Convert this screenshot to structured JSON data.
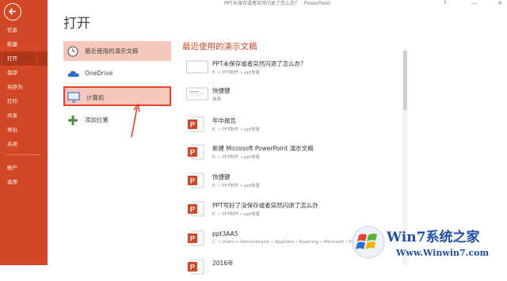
{
  "window": {
    "title": "PPT未保存或者突然闪退了怎么办？ - PowerPoint",
    "help": "?",
    "minimize": "—",
    "close": "✕"
  },
  "sidebar": {
    "items": [
      {
        "label": "信息"
      },
      {
        "label": "新建"
      },
      {
        "label": "打开",
        "active": true
      },
      {
        "label": "保存"
      },
      {
        "label": "另存为"
      },
      {
        "label": "打印"
      },
      {
        "label": "共享"
      },
      {
        "label": "导出"
      },
      {
        "label": "关闭"
      },
      {
        "label": "帐户"
      },
      {
        "label": "选项"
      }
    ],
    "accent": "#d24726"
  },
  "page_title": "打开",
  "locations": [
    {
      "label": "最近使用的演示文稿",
      "icon": "clock-icon"
    },
    {
      "label": "OneDrive",
      "icon": "cloud-icon"
    },
    {
      "label": "计算机",
      "icon": "computer-icon"
    },
    {
      "label": "添加位置",
      "icon": "plus-icon"
    }
  ],
  "recent": {
    "title": "最近使用的演示文稿",
    "items": [
      {
        "name": "PPT未保存或者突然闪退了怎么办？",
        "path": "E: » PPT制作 » ppt恢复",
        "icon": "blank-thumb"
      },
      {
        "name": "快捷键",
        "path": "桌面",
        "icon": "slide-thumb"
      },
      {
        "name": "年中报告",
        "path": "E: » PPT制作 » ppt恢复",
        "icon": "pptx-icon"
      },
      {
        "name": "新建 Microsoft PowerPoint 演示文稿",
        "path": "E: » PPT制作 » ppt恢复",
        "icon": "pptx-icon"
      },
      {
        "name": "快捷键",
        "path": "E: » PPT制作 » ppt恢复",
        "icon": "pptx-icon"
      },
      {
        "name": "PPT写好了没保存或者突然闪退了怎么办",
        "path": "E: » PPT制作 » ppt恢复",
        "icon": "pptx-icon"
      },
      {
        "name": "ppt3AA5",
        "path": "C: » Users » Administrator » AppData » Roaming » Microsoft » PowerPo...",
        "icon": "pptx-icon"
      },
      {
        "name": "2016年 ",
        "path": "",
        "icon": "pptx-icon"
      }
    ]
  },
  "watermark": {
    "brand": "Win7系统之家",
    "url": "Www.Winwin7.com"
  }
}
